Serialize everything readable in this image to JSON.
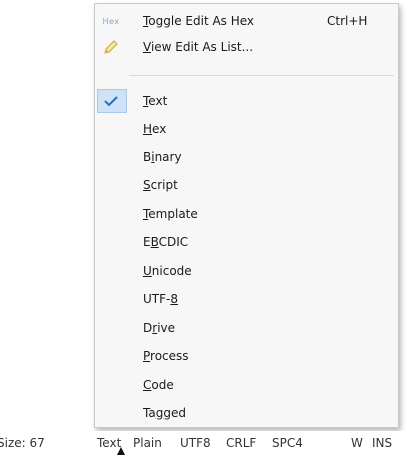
{
  "menu": {
    "toggle": {
      "icon_text": "Hex",
      "label": "Toggle Edit As Hex",
      "accel": "Ctrl+H",
      "u": "T",
      "rest": "oggle Edit As Hex"
    },
    "view_list": {
      "icon": "pencil-icon",
      "label": "View Edit As List...",
      "u": "V",
      "rest": "iew Edit As List..."
    },
    "items": [
      {
        "label": "Text",
        "pre": "",
        "u": "T",
        "post": "ext",
        "checked": true
      },
      {
        "label": "Hex",
        "pre": "",
        "u": "H",
        "post": "ex"
      },
      {
        "label": "Binary",
        "pre": "B",
        "u": "i",
        "post": "nary"
      },
      {
        "label": "Script",
        "pre": "",
        "u": "S",
        "post": "cript"
      },
      {
        "label": "Template",
        "pre": "",
        "u": "T",
        "post": "emplate"
      },
      {
        "label": "EBCDIC",
        "pre": "E",
        "u": "B",
        "post": "CDIC"
      },
      {
        "label": "Unicode",
        "pre": "",
        "u": "U",
        "post": "nicode"
      },
      {
        "label": "UTF-8",
        "pre": "UTF-",
        "u": "8",
        "post": ""
      },
      {
        "label": "Drive",
        "pre": "D",
        "u": "r",
        "post": "ive"
      },
      {
        "label": "Process",
        "pre": "",
        "u": "P",
        "post": "rocess"
      },
      {
        "label": "Code",
        "pre": "",
        "u": "C",
        "post": "ode"
      },
      {
        "label": "Tagged",
        "pre": "Ta",
        "u": "g",
        "post": "ged"
      }
    ]
  },
  "status": {
    "size": "Size: 67",
    "mode": "Text",
    "format": "Plain",
    "encoding": "UTF8",
    "line_ending": "CRLF",
    "indent": "SPC4",
    "width": "W",
    "insert": "INS"
  },
  "colors": {
    "check_bg": "#cfe3f7",
    "hex_icon": "#7fa7d6",
    "pencil": "#e8c95a"
  }
}
